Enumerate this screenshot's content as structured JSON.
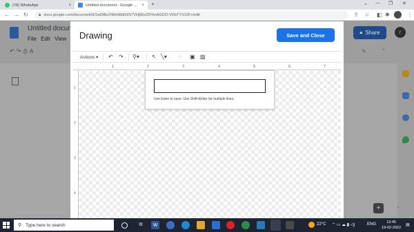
{
  "browser": {
    "tabs": [
      {
        "label": "(78) WhatsApp",
        "icon": "whatsapp-icon",
        "icon_color": "#25d366",
        "close": "×"
      },
      {
        "label": "Untitled document - Google Doc",
        "icon": "docs-icon",
        "icon_color": "#4285f4",
        "close": "×"
      }
    ],
    "new_tab": "+",
    "url": "docs.google.com/document/d/1wD8kvXMxN8dD9S7VHj96x22FlmAGDO-VDbTYS12Fc/edit",
    "window_controls": [
      "⌄",
      "—",
      "❐",
      "✕"
    ]
  },
  "docs": {
    "title": "Untitled docum",
    "menu": [
      "File",
      "Edit",
      "View"
    ],
    "share_label": "Share",
    "avatar_initial": "r"
  },
  "dialog": {
    "title": "Drawing",
    "save_button": "Save and Close",
    "toolbar": {
      "actions_label": "Actions",
      "actions_caret": "▾"
    },
    "ruler_h": [
      "1",
      "2",
      "3",
      "4",
      "5",
      "6",
      "7"
    ],
    "ruler_v": [
      "1",
      "2",
      "3",
      "4"
    ],
    "word_art_hint": "Use Enter to save. Use Shift+Enter for multiple lines."
  },
  "taskbar": {
    "search_placeholder": "Type here to search",
    "weather": "22°C",
    "language": "ENG",
    "time": "13:45",
    "date": "19-02-2022"
  },
  "colors": {
    "accent": "#1a73e8",
    "taskbar": "#1f2433"
  }
}
